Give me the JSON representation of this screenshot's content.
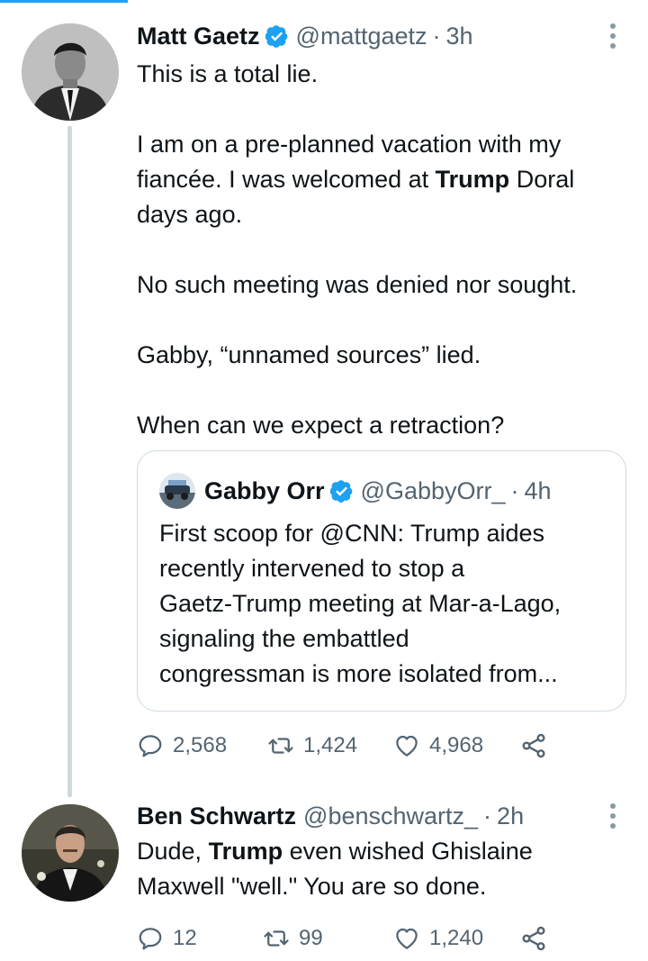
{
  "tweet1": {
    "name": "Matt Gaetz",
    "handle": "@mattgaetz",
    "dot": "·",
    "time": "3h",
    "lines": [
      "This is a total lie.",
      "I am on a pre-planned vacation with my",
      "fiancée. I was welcomed at ",
      "Trump",
      " Doral",
      "days ago.",
      "No such meeting was denied nor sought.",
      "Gabby, “unnamed sources” lied.",
      "When can we expect a retraction?"
    ],
    "quote": {
      "name": "Gabby Orr",
      "handle": "@GabbyOrr_",
      "dot": "·",
      "time": "4h",
      "lines": [
        "First scoop for @CNN: Trump aides",
        "recently intervened to stop a",
        "Gaetz-Trump meeting at Mar-a-Lago,",
        "signaling the embattled",
        "congressman is more isolated from..."
      ]
    },
    "replies": "2,568",
    "retweets": "1,424",
    "likes": "4,968"
  },
  "tweet2": {
    "name": "Ben Schwartz",
    "handle": "@benschwartz_",
    "dot": "·",
    "time": "2h",
    "line1_pre": "Dude, ",
    "line1_bold": "Trump",
    "line1_post": " even wished Ghislaine",
    "line2": "Maxwell \"well.\"  You are so done.",
    "replies": "12",
    "retweets": "99",
    "likes": "1,240"
  },
  "colors": {
    "accent": "#1da1f2",
    "secondary_text": "#536471",
    "border": "#cfd9de"
  },
  "icons": [
    "verified-badge-icon",
    "more-options-icon",
    "reply-icon",
    "retweet-icon",
    "like-icon",
    "share-icon"
  ]
}
